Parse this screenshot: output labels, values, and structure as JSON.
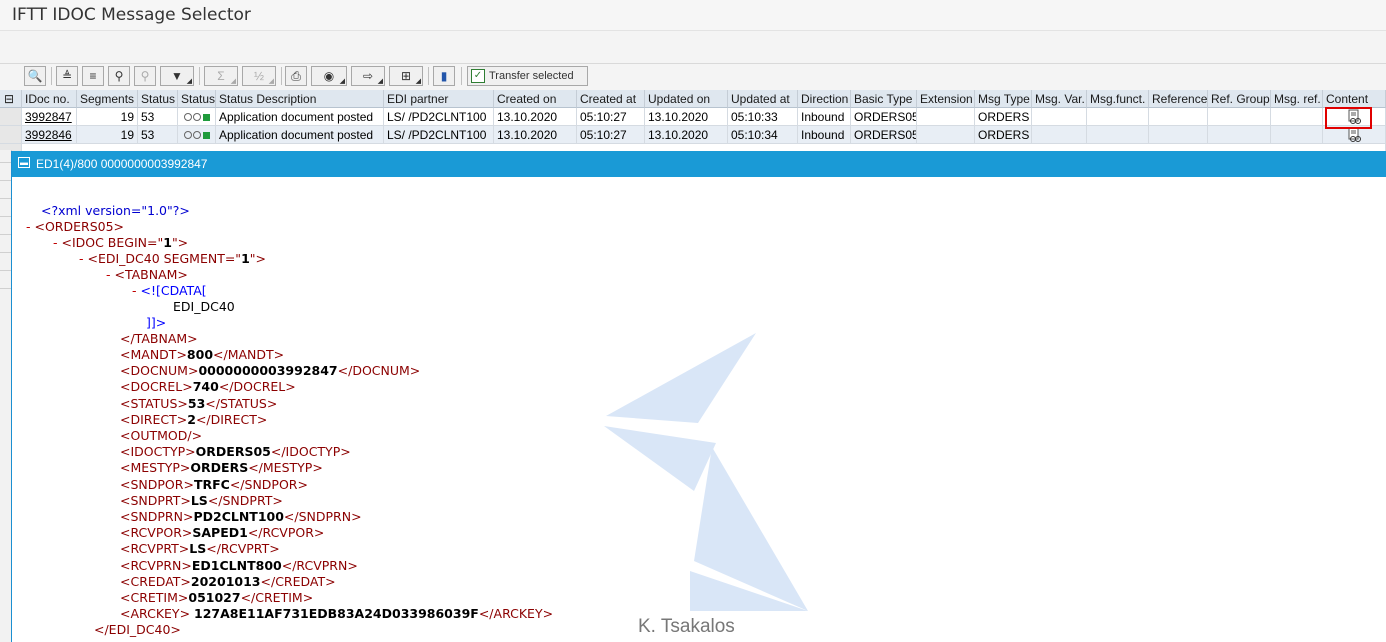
{
  "app": {
    "title": "IFTT IDOC Message Selector"
  },
  "toolbar": {
    "transfer_label": "Transfer selected",
    "icons": [
      "details-icon",
      "sort-asc-icon",
      "sort-desc-icon",
      "find-icon",
      "find-next-icon",
      "filter-icon",
      "sum-icon",
      "subtotal-icon",
      "print-icon",
      "views-icon",
      "export-icon",
      "layout-icon",
      "graphic-icon"
    ]
  },
  "grid": {
    "columns": [
      "IDoc no.",
      "Segments",
      "Status",
      "Status",
      "Status Description",
      "EDI partner",
      "Created on",
      "Created at",
      "Updated on",
      "Updated at",
      "Direction",
      "Basic Type",
      "Extension",
      "Msg Type",
      "Msg. Var.",
      "Msg.funct.",
      "Reference",
      "Ref. Group",
      "Msg. ref.",
      "Content"
    ],
    "rows": [
      {
        "idoc": "3992847",
        "segments": "19",
        "status": "53",
        "description": "Application document posted",
        "partner": "LS/  /PD2CLNT100",
        "created_on": "13.10.2020",
        "created_at": "05:10:27",
        "updated_on": "13.10.2020",
        "updated_at": "05:10:33",
        "direction": "Inbound",
        "basic_type": "ORDERS05",
        "extension": "",
        "msg_type": "ORDERS",
        "msg_var": "",
        "msg_funct": "",
        "reference": "",
        "ref_group": "",
        "msg_ref": ""
      },
      {
        "idoc": "3992846",
        "segments": "19",
        "status": "53",
        "description": "Application document posted",
        "partner": "LS/  /PD2CLNT100",
        "created_on": "13.10.2020",
        "created_at": "05:10:27",
        "updated_on": "13.10.2020",
        "updated_at": "05:10:34",
        "direction": "Inbound",
        "basic_type": "ORDERS05",
        "extension": "",
        "msg_type": "ORDERS",
        "msg_var": "",
        "msg_funct": "",
        "reference": "",
        "ref_group": "",
        "msg_ref": ""
      }
    ]
  },
  "popup": {
    "title": "ED1(4)/800 0000000003992847",
    "xml": {
      "decl": "<?xml version=\"1.0\"?>",
      "root_open": "<ORDERS05>",
      "idoc_open_pre": "<IDOC BEGIN=\"",
      "idoc_begin": "1",
      "idoc_open_post": "\">",
      "dc40_open_pre": "<EDI_DC40 SEGMENT=\"",
      "dc40_segment": "1",
      "dc40_open_post": "\">",
      "tabnam_open": "<TABNAM>",
      "cdata_open": "<![CDATA[",
      "cdata_value": "EDI_DC40",
      "cdata_close": "]]>",
      "tabnam_close": "</TABNAM>",
      "fields": [
        {
          "tag": "MANDT",
          "value": "800"
        },
        {
          "tag": "DOCNUM",
          "value": "0000000003992847"
        },
        {
          "tag": "DOCREL",
          "value": "740"
        },
        {
          "tag": "STATUS",
          "value": "53"
        },
        {
          "tag": "DIRECT",
          "value": "2"
        },
        {
          "tag": "OUTMOD",
          "value": ""
        },
        {
          "tag": "IDOCTYP",
          "value": "ORDERS05"
        },
        {
          "tag": "MESTYP",
          "value": "ORDERS"
        },
        {
          "tag": "SNDPOR",
          "value": "TRFC"
        },
        {
          "tag": "SNDPRT",
          "value": "LS"
        },
        {
          "tag": "SNDPRN",
          "value": "PD2CLNT100"
        },
        {
          "tag": "RCVPOR",
          "value": "SAPED1"
        },
        {
          "tag": "RCVPRT",
          "value": "LS"
        },
        {
          "tag": "RCVPRN",
          "value": "ED1CLNT800"
        },
        {
          "tag": "CREDAT",
          "value": "20201013"
        },
        {
          "tag": "CRETIM",
          "value": "051027"
        },
        {
          "tag": "ARCKEY",
          "value": "127A8E11AF731EDB83A24D033986039F"
        }
      ],
      "dc40_close": "</EDI_DC40>"
    }
  },
  "watermark_author": "K. Tsakalos",
  "colors": {
    "popup_header": "#1a9ad6",
    "highlight": "#e00000",
    "status_green": "#1f9b3c"
  }
}
